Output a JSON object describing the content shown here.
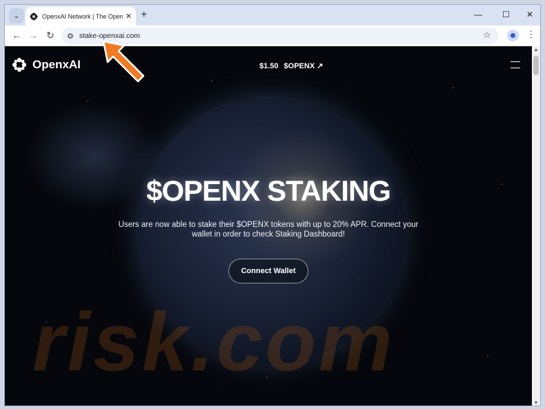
{
  "browser": {
    "tab_title": "OpenxAI Network | The Open a",
    "url": "stake-openxai.com",
    "controls": {
      "minimize": "—",
      "maximize": "☐",
      "close": "✕",
      "new_tab": "+"
    }
  },
  "site": {
    "logo_text": "OpenxAI",
    "price": "$1.50",
    "ticker": "$OPENX ↗",
    "hero_title": "$OPENX STAKING",
    "hero_subtitle": "Users are now able to stake their $OPENX tokens with up to 20% APR. Connect your wallet in order to check Staking Dashboard!",
    "cta_label": "Connect Wallet"
  },
  "watermark": "risk.com",
  "colors": {
    "accent_arrow": "#f07a24",
    "page_bg": "#05070c"
  }
}
